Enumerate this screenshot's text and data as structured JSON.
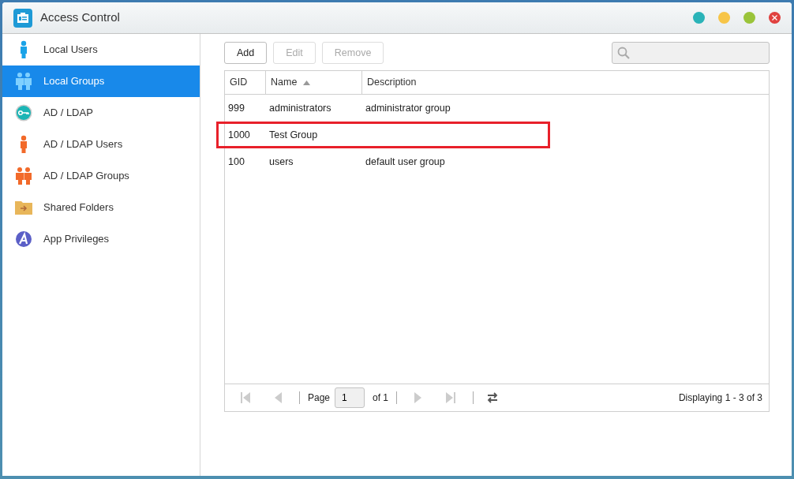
{
  "window": {
    "title": "Access Control",
    "controls": [
      {
        "kind": "dot",
        "color": "#2ab3b8"
      },
      {
        "kind": "dot",
        "color": "#f7c548"
      },
      {
        "kind": "dot",
        "color": "#9ac43a"
      },
      {
        "kind": "close",
        "color": "#e0413f"
      }
    ]
  },
  "sidebar": {
    "items": [
      {
        "label": "Local Users",
        "selected": false
      },
      {
        "label": "Local Groups",
        "selected": true
      },
      {
        "label": "AD / LDAP",
        "selected": false
      },
      {
        "label": "AD / LDAP Users",
        "selected": false
      },
      {
        "label": "AD / LDAP Groups",
        "selected": false
      },
      {
        "label": "Shared Folders",
        "selected": false
      },
      {
        "label": "App Privileges",
        "selected": false
      }
    ]
  },
  "toolbar": {
    "buttons": [
      {
        "label": "Add",
        "disabled": false
      },
      {
        "label": "Edit",
        "disabled": true
      },
      {
        "label": "Remove",
        "disabled": true
      }
    ]
  },
  "table": {
    "columns": [
      {
        "label": "GID",
        "sorted": false
      },
      {
        "label": "Name",
        "sorted": true
      },
      {
        "label": "Description",
        "sorted": false
      }
    ],
    "rows": [
      {
        "gid": "999",
        "name": "administrators",
        "description": "administrator group",
        "highlighted": false
      },
      {
        "gid": "1000",
        "name": "Test Group",
        "highlighted": true
      },
      {
        "gid": "100",
        "name": "users",
        "description": "default user group",
        "highlighted": false
      }
    ]
  },
  "pager": {
    "page_label": "Page",
    "page": "1",
    "of": "of 1",
    "summary": "Displaying 1 - 3 of 3"
  }
}
